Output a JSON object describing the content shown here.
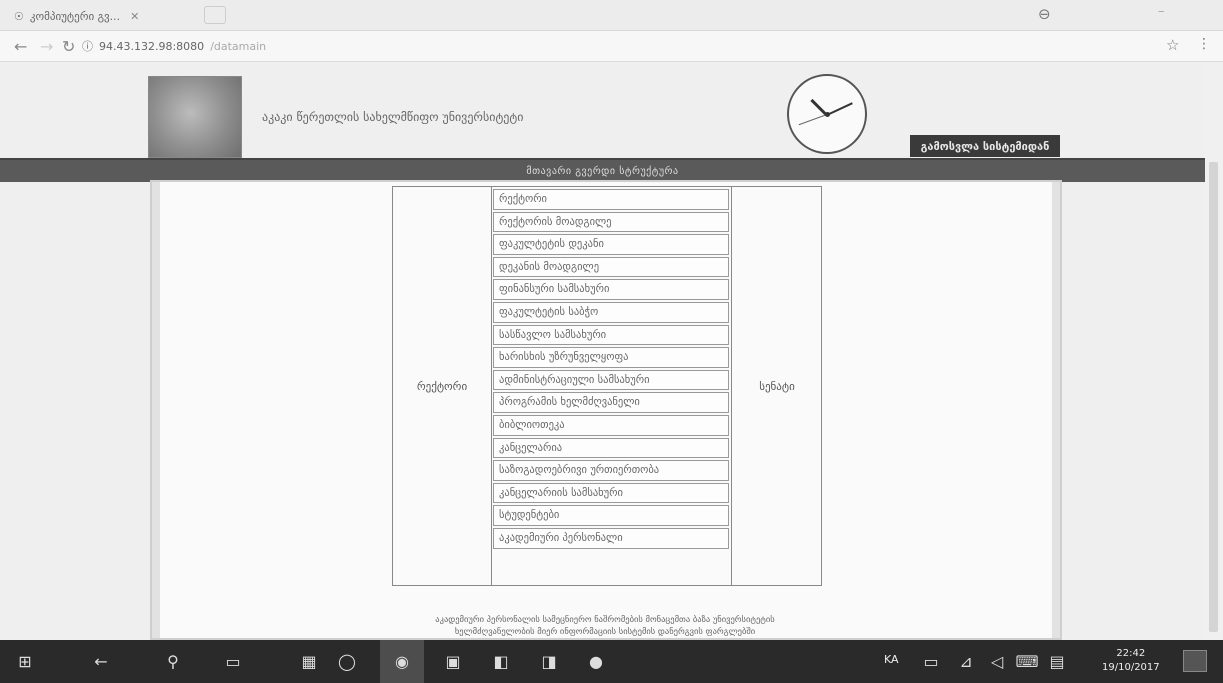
{
  "browser": {
    "tab_title": "კომპიუტერი გვ...",
    "tab_close": "✕",
    "url_host": "94.43.132.98:8080",
    "url_path": "/datamain"
  },
  "site": {
    "title": "აკაკი წერეთლის სახელმწიფო უნივერსიტეტი",
    "user_box": "გამოსვლა სისტემიდან",
    "menu_bar": "მთავარი გვერდი სტრუქტურა"
  },
  "structure": {
    "left_label": "რექტორი",
    "right_label": "სენატი",
    "units": [
      "რექტორი",
      "რექტორის მოადგილე",
      "ფაკულტეტის დეკანი",
      "დეკანის მოადგილე",
      "ფინანსური სამსახური",
      "ფაკულტეტის საბჭო",
      "სასწავლო სამსახური",
      "ხარისხის უზრუნველყოფა",
      "ადმინისტრაციული სამსახური",
      "პროგრამის ხელმძღვანელი",
      "ბიბლიოთეკა",
      "კანცელარია",
      "საზოგადოებრივი ურთიერთობა",
      "კანცელარიის სამსახური",
      "სტუდენტები",
      "აკადემიური პერსონალი"
    ]
  },
  "footer_note_line1": "აკადემიური პერსონალის სამეცნიერო ნაშრომების მონაცემთა ბაზა უნივერსიტეტის",
  "footer_note_line2": "ხელმძღვანელობის მიერ ინფორმაციის სისტემის დანერგვის ფარგლებში",
  "taskbar": {
    "lang": "KA",
    "time": "22:42",
    "date": "19/10/2017"
  }
}
